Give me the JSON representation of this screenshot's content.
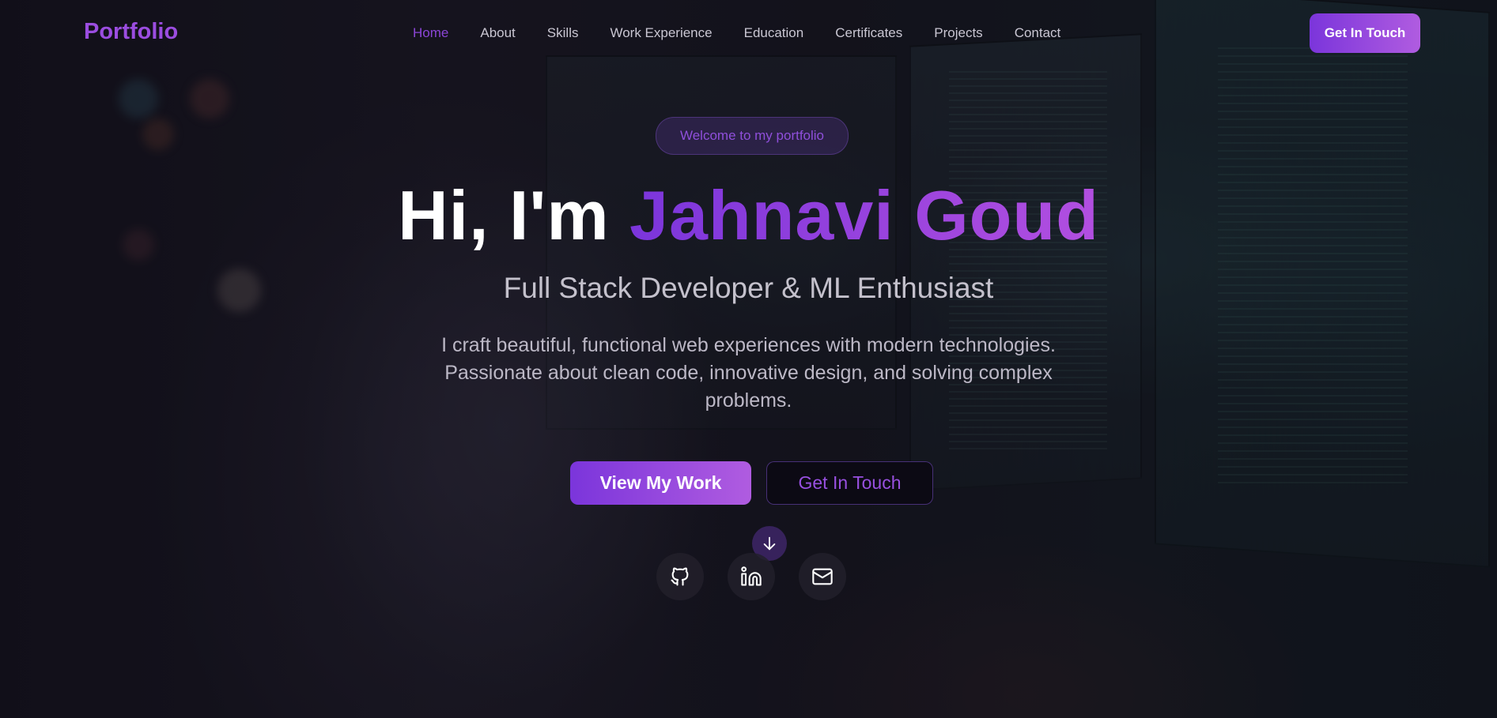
{
  "navbar": {
    "brand": "Portfolio",
    "links": [
      {
        "label": "Home",
        "active": true
      },
      {
        "label": "About",
        "active": false
      },
      {
        "label": "Skills",
        "active": false
      },
      {
        "label": "Work Experience",
        "active": false
      },
      {
        "label": "Education",
        "active": false
      },
      {
        "label": "Certificates",
        "active": false
      },
      {
        "label": "Projects",
        "active": false
      },
      {
        "label": "Contact",
        "active": false
      }
    ],
    "cta_label": "Get In Touch"
  },
  "hero": {
    "badge": "Welcome to my portfolio",
    "greeting": "Hi, I'm ",
    "name": "Jahnavi Goud",
    "subtitle": "Full Stack Developer & ML Enthusiast",
    "description": "I craft beautiful, functional web experiences with modern technologies. Passionate about clean code, innovative design, and solving complex problems.",
    "primary_button": "View My Work",
    "secondary_button": "Get In Touch"
  },
  "icons": {
    "scroll": "arrow-down-icon",
    "social": [
      "github-icon",
      "linkedin-icon",
      "mail-icon"
    ]
  },
  "colors": {
    "accent": "#8b45d6",
    "accent_gradient_start": "#7b35db",
    "accent_gradient_end": "#b05ce0",
    "background": "#0d0b14"
  }
}
